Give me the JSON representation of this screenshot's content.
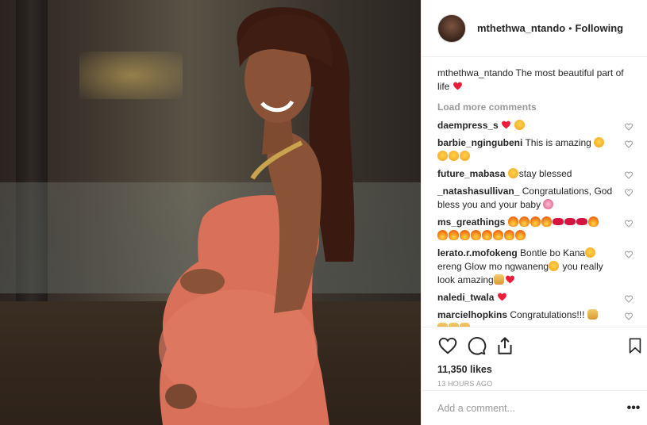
{
  "header": {
    "username": "mthethwa_ntando",
    "separator": "•",
    "follow_status": "Following"
  },
  "caption": {
    "username": "mthethwa_ntando",
    "text": "The most beautiful part of life"
  },
  "load_more": "Load more comments",
  "comments": [
    {
      "user": "daempress_s",
      "text": ""
    },
    {
      "user": "barbie_ngingubeni",
      "text": "This is amazing"
    },
    {
      "user": "future_mabasa",
      "text": "stay blessed"
    },
    {
      "user": "_natashasullivan_",
      "text": "Congratulations, God bless you and your baby"
    },
    {
      "user": "ms_greathings",
      "text": ""
    },
    {
      "user": "lerato.r.mofokeng",
      "text_part1": "Bontle bo Kana",
      "text_part2": "ereng Glow mo ngwaneng",
      "text_part3": "you really look amazing"
    },
    {
      "user": "naledi_twala",
      "text": ""
    },
    {
      "user": "marcielhopkins",
      "text": "Congratulations!!!"
    }
  ],
  "likes": "11,350 likes",
  "time": "13 HOURS AGO",
  "add_comment": {
    "placeholder": "Add a comment..."
  },
  "more_label": "•••",
  "icons": [
    "heart-outline-icon",
    "comment-icon",
    "share-icon",
    "bookmark-icon"
  ],
  "colors": {
    "heart": "#ed4956",
    "muted": "#999999",
    "border": "#efefef"
  }
}
